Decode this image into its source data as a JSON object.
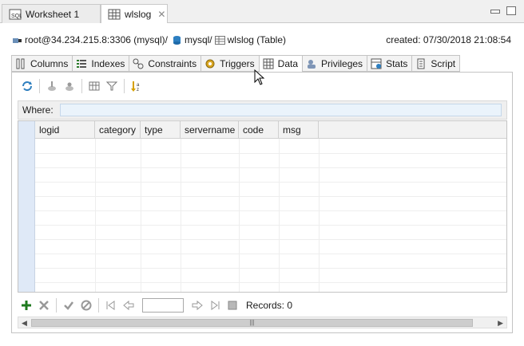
{
  "editor_tabs": [
    {
      "label": "Worksheet 1",
      "icon": "worksheet-icon",
      "active": false
    },
    {
      "label": "wlslog",
      "icon": "table-icon",
      "active": true
    }
  ],
  "breadcrumb": {
    "connection": "root@34.234.215.8:3306 (mysql)/",
    "schema": "mysql/",
    "table": "wlslog (Table)"
  },
  "created": "created: 07/30/2018 21:08:54",
  "inner_tabs": [
    {
      "label": "Columns",
      "icon": "columns-icon"
    },
    {
      "label": "Indexes",
      "icon": "indexes-icon"
    },
    {
      "label": "Constraints",
      "icon": "constraints-icon"
    },
    {
      "label": "Triggers",
      "icon": "gear-icon"
    },
    {
      "label": "Data",
      "icon": "grid-icon",
      "active": true
    },
    {
      "label": "Privileges",
      "icon": "privileges-icon"
    },
    {
      "label": "Stats",
      "icon": "stats-icon"
    },
    {
      "label": "Script",
      "icon": "script-icon"
    }
  ],
  "where": {
    "label": "Where:",
    "value": ""
  },
  "columns": [
    "logid",
    "category",
    "type",
    "servername",
    "code",
    "msg"
  ],
  "navigation": {
    "page_value": "",
    "records": "Records: 0"
  },
  "colors": {
    "accent": "#1e7a1e",
    "row_header": "#dfe9f7",
    "where_input": "#eaf3fb"
  }
}
